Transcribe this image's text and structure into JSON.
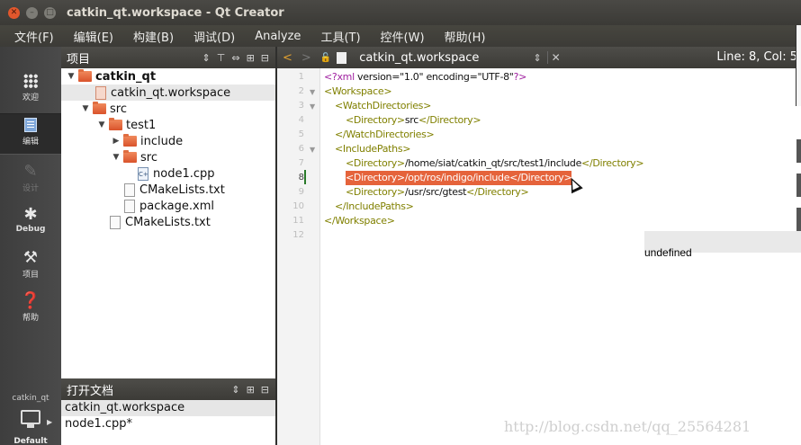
{
  "window": {
    "title": "catkin_qt.workspace - Qt Creator"
  },
  "menu": [
    "文件(F)",
    "编辑(E)",
    "构建(B)",
    "调试(D)",
    "Analyze",
    "工具(T)",
    "控件(W)",
    "帮助(H)"
  ],
  "modes": [
    {
      "label": "欢迎",
      "icon": "grid-icon"
    },
    {
      "label": "编辑",
      "icon": "edit-doc-icon",
      "active": true
    },
    {
      "label": "设计",
      "icon": "pencil-icon",
      "disabled": true
    },
    {
      "label": "Debug",
      "icon": "bug-icon"
    },
    {
      "label": "项目",
      "icon": "wrench-icon"
    },
    {
      "label": "帮助",
      "icon": "help-icon"
    }
  ],
  "kit": {
    "project": "catkin_qt",
    "config": "Default"
  },
  "projects_panel": {
    "title": "项目",
    "tree": [
      "catkin_qt",
      "catkin_qt.workspace",
      "src",
      "test1",
      "include",
      "src",
      "node1.cpp",
      "CMakeLists.txt",
      "package.xml",
      "CMakeLists.txt"
    ]
  },
  "open_docs": {
    "title": "打开文档",
    "items": [
      "catkin_qt.workspace",
      "node1.cpp*"
    ]
  },
  "editor": {
    "file": "catkin_qt.workspace",
    "position": "Line: 8, Col: 5",
    "current_line": 8,
    "line_numbers": [
      "1",
      "2",
      "3",
      "4",
      "5",
      "6",
      "7",
      "8",
      "9",
      "10",
      "11",
      "12"
    ],
    "lines": {
      "l1_pi": "<?xml",
      "l1_txt": " version=\"1.0\" encoding=\"UTF-8\"",
      "l1_end": "?>",
      "l2": "<Workspace>",
      "l3": "<WatchDirectories>",
      "l4_open": "<Directory>",
      "l4_txt": "src",
      "l4_close": "</Directory>",
      "l5": "</WatchDirectories>",
      "l6": "<IncludePaths>",
      "l7_open": "<Directory>",
      "l7_txt": "/home/siat/catkin_qt/src/test1/include",
      "l7_close": "</Directory>",
      "l8_open": "<Directory>",
      "l8_txt": "/opt/ros/indigo/include",
      "l8_close": "</Directory>",
      "l9_open": "<Directory>",
      "l9_txt": "/usr/src/gtest",
      "l9_close": "</Directory>",
      "l10": "</IncludePaths>",
      "l11": "</Workspace>"
    }
  },
  "overlay_text": "undefined",
  "watermark": "http://blog.csdn.net/qq_25564281"
}
